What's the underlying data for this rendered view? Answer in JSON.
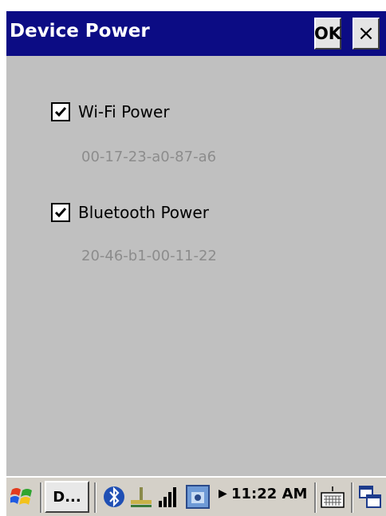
{
  "window": {
    "title": "Device Power",
    "ok_label": "OK",
    "close_label": "×"
  },
  "wifi": {
    "label": "Wi-Fi Power",
    "checked": true,
    "mac": "00-17-23-a0-87-a6"
  },
  "bluetooth": {
    "label": "Bluetooth Power",
    "checked": true,
    "mac": "20-46-b1-00-11-22"
  },
  "taskbar": {
    "task_label": "D...",
    "time": "11:22 AM"
  },
  "colors": {
    "titlebar": "#0c0c84",
    "background": "#c0c0c0",
    "mac_text": "#8c8c8c"
  },
  "icons": [
    "windows-start-icon",
    "bluetooth-icon",
    "network-icon",
    "signal-bars-icon",
    "wifi-adapter-icon",
    "keyboard-icon",
    "window-switch-icon"
  ]
}
